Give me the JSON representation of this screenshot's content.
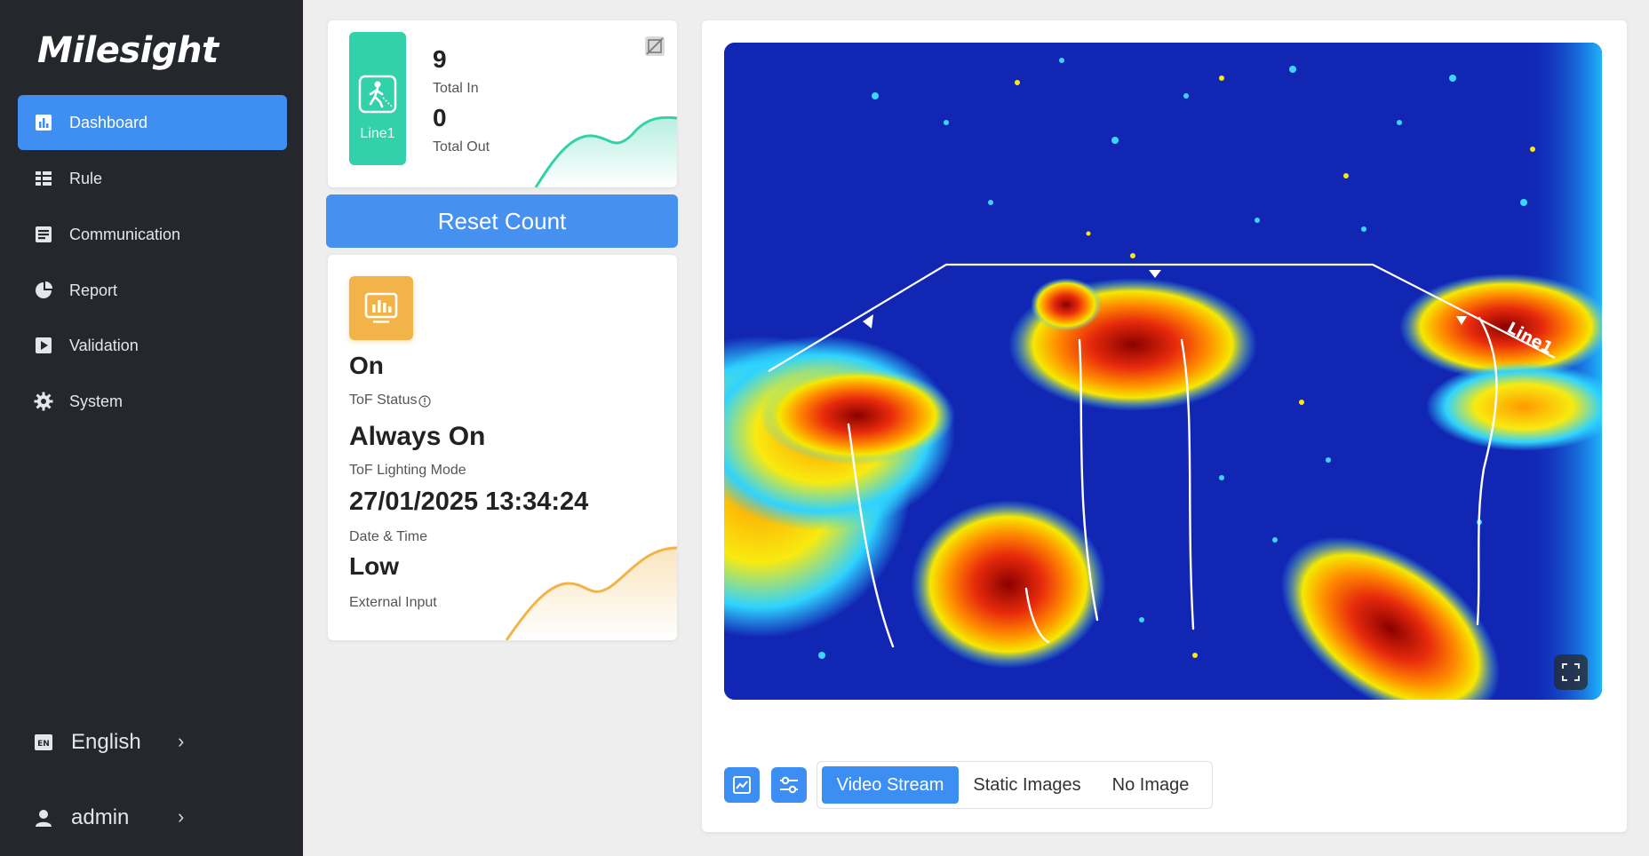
{
  "brand": {
    "logo": "Milesight"
  },
  "sidebar": {
    "items": [
      {
        "label": "Dashboard",
        "icon": "dashboard-icon",
        "active": true
      },
      {
        "label": "Rule",
        "icon": "rule-icon",
        "active": false
      },
      {
        "label": "Communication",
        "icon": "communication-icon",
        "active": false
      },
      {
        "label": "Report",
        "icon": "pie-chart-icon",
        "active": false
      },
      {
        "label": "Validation",
        "icon": "play-square-icon",
        "active": false
      },
      {
        "label": "System",
        "icon": "gear-icon",
        "active": false
      }
    ],
    "language": {
      "label": "English",
      "icon": "en-icon"
    },
    "user": {
      "label": "admin",
      "icon": "user-icon"
    }
  },
  "counter": {
    "line_label": "Line1",
    "total_in_value": "9",
    "total_in_label": "Total In",
    "total_out_value": "0",
    "total_out_label": "Total Out",
    "accent_color": "#33d1a9"
  },
  "reset_button": {
    "label": "Reset Count"
  },
  "status": {
    "tof_status_value": "On",
    "tof_status_label": "ToF Status",
    "lighting_mode_value": "Always On",
    "lighting_mode_label": "ToF Lighting Mode",
    "datetime_value": "27/01/2025 13:34:24",
    "datetime_label": "Date & Time",
    "external_input_value": "Low",
    "external_input_label": "External Input",
    "accent_color": "#f2b448"
  },
  "video": {
    "line_overlay_label": "Line1",
    "tabs": [
      {
        "label": "Video Stream",
        "active": true
      },
      {
        "label": "Static Images",
        "active": false
      },
      {
        "label": "No Image",
        "active": false
      }
    ]
  },
  "colors": {
    "primary": "#3f8ff3",
    "sidebar_bg": "#24282d"
  }
}
